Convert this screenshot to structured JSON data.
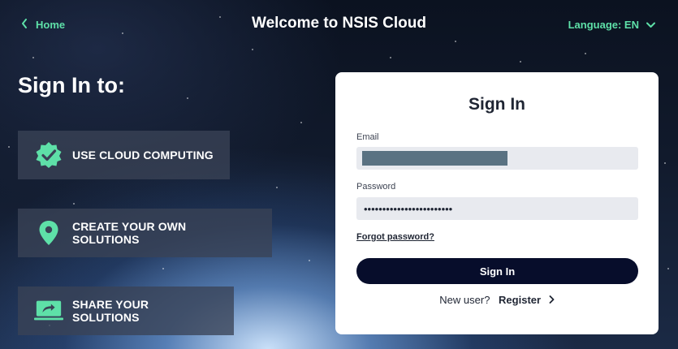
{
  "header": {
    "home_label": "Home",
    "title": "Welcome to NSIS Cloud",
    "language_label": "Language: EN"
  },
  "left": {
    "heading": "Sign In to:",
    "features": [
      {
        "label": "USE CLOUD COMPUTING",
        "icon": "verified-badge-icon"
      },
      {
        "label": "CREATE YOUR OWN SOLUTIONS",
        "icon": "map-pin-icon"
      },
      {
        "label": "SHARE YOUR SOLUTIONS",
        "icon": "share-screen-icon"
      }
    ]
  },
  "form": {
    "title": "Sign In",
    "email_label": "Email",
    "email_value": "",
    "password_label": "Password",
    "password_value": "••••••••••••••••••••••••",
    "forgot_label": "Forgot password?",
    "submit_label": "Sign In",
    "new_user_text": "New user?",
    "register_label": "Register"
  },
  "colors": {
    "accent": "#5ee0a8",
    "button": "#070d2b",
    "input_bg": "#e8eaef",
    "feature_bg": "#3a4256"
  }
}
